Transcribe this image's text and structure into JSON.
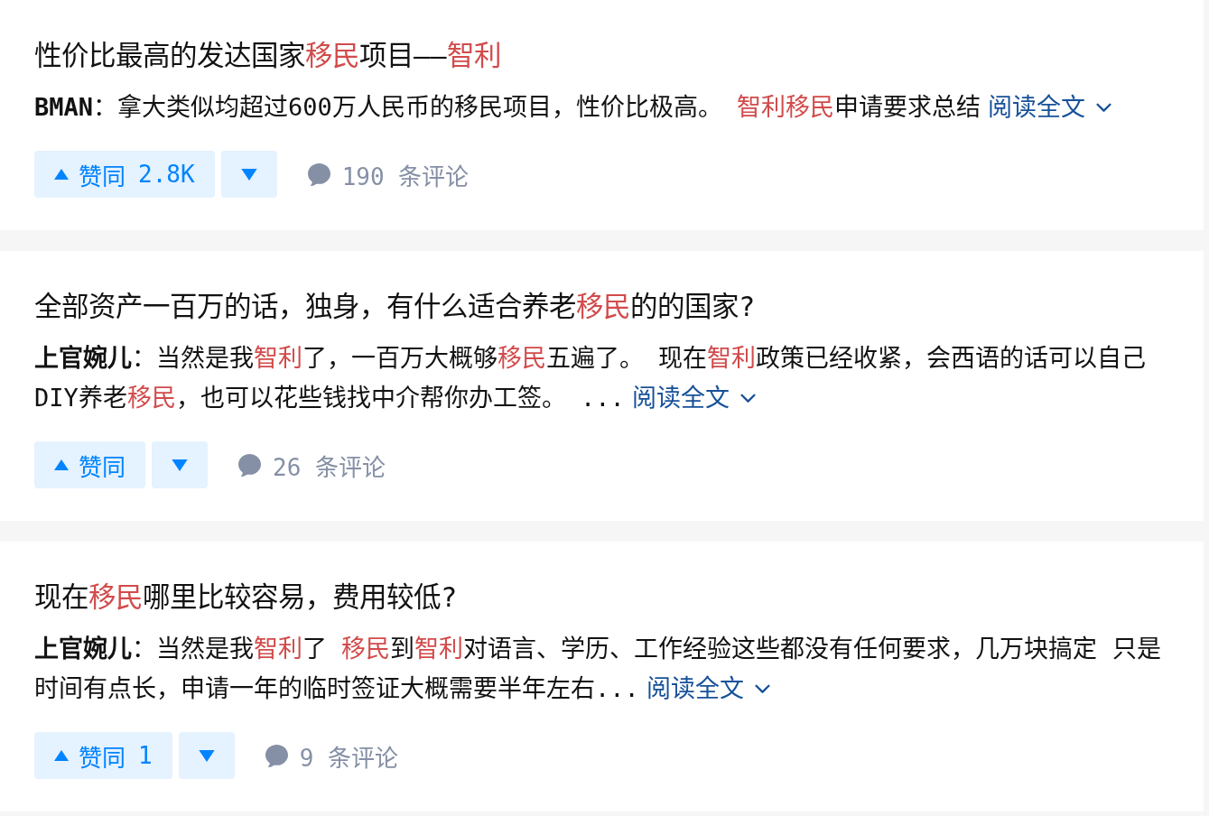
{
  "feed": [
    {
      "title": [
        {
          "text": "性价比最高的发达国家",
          "highlight": false
        },
        {
          "text": "移民",
          "highlight": true
        },
        {
          "text": "项目——",
          "highlight": false
        },
        {
          "text": "智利",
          "highlight": true
        }
      ],
      "excerpt": {
        "author": "BMAN",
        "segments": [
          {
            "text": "：拿大类似均超过600万人民币的移民项目，性价比极高。 ",
            "highlight": false
          },
          {
            "text": "智利移民",
            "highlight": true
          },
          {
            "text": "申请要求总结",
            "highlight": false
          }
        ]
      },
      "read_more": "阅读全文",
      "upvote": {
        "label": "赞同",
        "count": "2.8K"
      },
      "comments": "190 条评论"
    },
    {
      "title": [
        {
          "text": "全部资产一百万的话，独身，有什么适合养老",
          "highlight": false
        },
        {
          "text": "移民",
          "highlight": true
        },
        {
          "text": "的的国家?",
          "highlight": false
        }
      ],
      "excerpt": {
        "author": "上官婉儿",
        "segments": [
          {
            "text": "：当然是我",
            "highlight": false
          },
          {
            "text": "智利",
            "highlight": true
          },
          {
            "text": "了，一百万大概够",
            "highlight": false
          },
          {
            "text": "移民",
            "highlight": true
          },
          {
            "text": "五遍了。 现在",
            "highlight": false
          },
          {
            "text": "智利",
            "highlight": true
          },
          {
            "text": "政策已经收紧，会西语的话可以自己DIY养老",
            "highlight": false
          },
          {
            "text": "移民",
            "highlight": true
          },
          {
            "text": "，也可以花些钱找中介帮你办工签。 ...",
            "highlight": false
          }
        ]
      },
      "read_more": "阅读全文",
      "upvote": {
        "label": "赞同"
      },
      "comments": "26 条评论"
    },
    {
      "title": [
        {
          "text": "现在",
          "highlight": false
        },
        {
          "text": "移民",
          "highlight": true
        },
        {
          "text": "哪里比较容易，费用较低?",
          "highlight": false
        }
      ],
      "excerpt": {
        "author": "上官婉儿",
        "segments": [
          {
            "text": "：当然是我",
            "highlight": false
          },
          {
            "text": "智利",
            "highlight": true
          },
          {
            "text": "了 ",
            "highlight": false
          },
          {
            "text": "移民",
            "highlight": true
          },
          {
            "text": "到",
            "highlight": false
          },
          {
            "text": "智利",
            "highlight": true
          },
          {
            "text": "对语言、学历、工作经验这些都没有任何要求，几万块搞定 只是时间有点长，申请一年的临时签证大概需要半年左右...",
            "highlight": false
          }
        ]
      },
      "read_more": "阅读全文",
      "upvote": {
        "label": "赞同",
        "count": "1"
      },
      "comments": "9 条评论"
    }
  ]
}
